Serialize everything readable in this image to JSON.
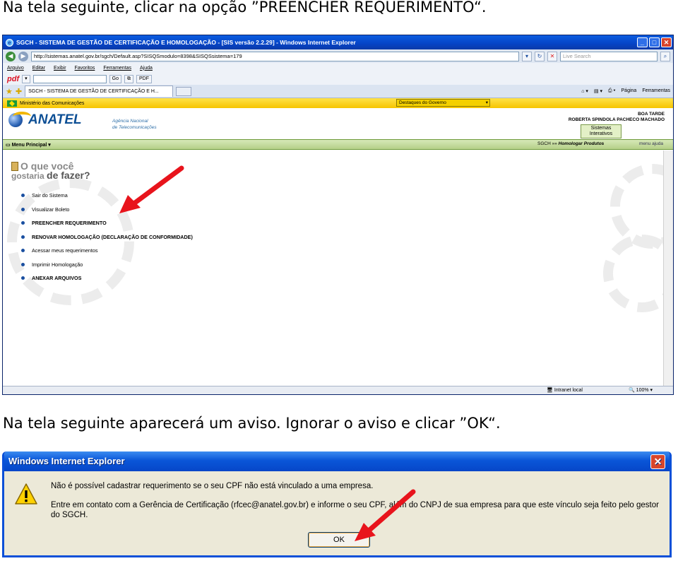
{
  "captions": {
    "step1": "Na tela seguinte, clicar na opção ”PREENCHER REQUERIMENTO“.",
    "step2": "Na tela seguinte aparecerá um aviso. Ignorar o aviso e clicar ”OK“."
  },
  "browser": {
    "window_title": "SGCH - SISTEMA DE GESTÃO DE CERTIFICAÇÃO E HOMOLOGAÇÃO - [SIS versão 2.2.29] - Windows Internet Explorer",
    "address": "http://sistemas.anatel.gov.br/sgch/Default.asp?SISQSmodulo=8398&SISQSsistema=179",
    "search_placeholder": "Live Search",
    "menu": [
      "Arquivo",
      "Editar",
      "Exibir",
      "Favoritos",
      "Ferramentas",
      "Ajuda"
    ],
    "pdf_bar": {
      "logo": "pdf",
      "go": "Go",
      "pdf_label": "PDF"
    },
    "tab_title": "SGCH - SISTEMA DE GESTÃO DE CERTIFICAÇÃO E H...",
    "toolbar_right": [
      "Página",
      "Ferramentas"
    ],
    "status_zone": "Intranet local",
    "status_zoom": "100%"
  },
  "page": {
    "gov_bar": "Ministério das Comunicações",
    "destaques": "Destaques do Governo",
    "logo_text": "ANATEL",
    "agency_line1": "Agência Nacional",
    "agency_line2": "de Telecomunicações",
    "greeting": "BOA TARDE",
    "user_name": "ROBERTA SPINDOLA PACHECO MACHADO",
    "sistemas_line1": "Sistemas",
    "sistemas_line2": "Interativos",
    "menu_principal": "Menu Principal",
    "breadcrumb_root": "SGCH »»",
    "breadcrumb_current": "Homologar Produtos",
    "menu_link": "menu",
    "help_link": "ajuda",
    "question_line1": "O que você",
    "question_line2a": "gostaria",
    "question_line2b": "de fazer?",
    "options": [
      {
        "label": "Sair do Sistema",
        "bold": false
      },
      {
        "label": "Visualizar Boleto",
        "bold": false
      },
      {
        "label": "PREENCHER REQUERIMENTO",
        "bold": true
      },
      {
        "label": "RENOVAR HOMOLOGAÇÃO (DECLARAÇÃO DE CONFORMIDADE)",
        "bold": true
      },
      {
        "label": "Acessar meus requerimentos",
        "bold": false
      },
      {
        "label": "Imprimir Homologação",
        "bold": false
      },
      {
        "label": "ANEXAR ARQUIVOS",
        "bold": true
      }
    ]
  },
  "dialog": {
    "title": "Windows Internet Explorer",
    "message1": "Não é possível cadastrar requerimento se o seu CPF não está vinculado a uma empresa.",
    "message2": "Entre em contato com a Gerência de Certificação (rfcec@anatel.gov.br) e informe o seu CPF, além do CNPJ de sua empresa para que este vínculo seja feito pelo gestor do SGCH.",
    "ok_label": "OK"
  },
  "colors": {
    "annotation_arrow": "#e8141c",
    "xp_blue": "#0a56d8",
    "gov_yellow": "#f6c500",
    "anatel_blue": "#0d4f95"
  }
}
